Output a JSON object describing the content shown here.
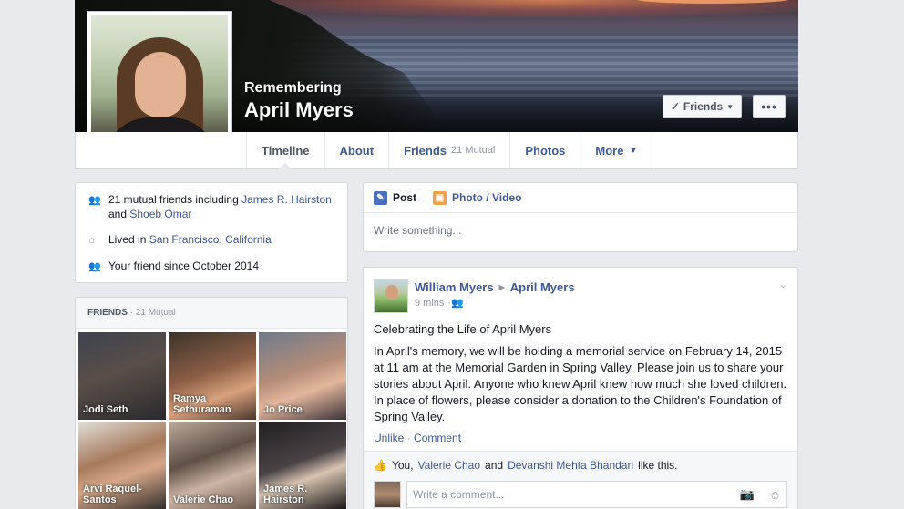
{
  "cover": {
    "subtitle": "Remembering",
    "name": "April Myers"
  },
  "header_buttons": {
    "friends_label": "Friends",
    "friends_check_icon": "check-icon",
    "more_label": "•••"
  },
  "nav": {
    "tabs": [
      {
        "label": "Timeline"
      },
      {
        "label": "About"
      },
      {
        "label": "Friends",
        "count": "21 Mutual"
      },
      {
        "label": "Photos"
      },
      {
        "label": "More"
      }
    ]
  },
  "intro": {
    "mutual_prefix": "21 mutual friends including",
    "mutual_friend_1": "James R. Hairston",
    "mutual_and": "and",
    "mutual_friend_2": "Shoeb Omar",
    "lived_prefix": "Lived in",
    "lived_place": "San Francisco, California",
    "friend_since": "Your friend since October 2014"
  },
  "friends_box": {
    "title": "FRIENDS",
    "mutual": "· 21 Mutual",
    "tiles": [
      "Jodi Seth",
      "Ramya Sethuraman",
      "Jo Price",
      "Arvi Raquel-Santos",
      "Valerie Chao",
      "James R. Hairston"
    ]
  },
  "composer": {
    "post_label": "Post",
    "photo_label": "Photo / Video",
    "placeholder": "Write something..."
  },
  "post": {
    "author": "William Myers",
    "target": "April Myers",
    "time": "9 mins",
    "title": "Celebrating the Life of April Myers",
    "body": "In April's memory, we will be holding a memorial service on February 14, 2015 at 11 am at the Memorial Garden in Spring Valley. Please join us to share your stories about April. Anyone who knew April knew how much she loved children. In place of flowers, please consider a donation to the Children's Foundation of Spring Valley.",
    "unlike": "Unlike",
    "comment": "Comment",
    "likes_you": "You,",
    "likes_person_1": "Valerie Chao",
    "likes_and": "and",
    "likes_person_2": "Devanshi Mehta Bhandari",
    "likes_suffix": "like this.",
    "comment_placeholder": "Write a comment..."
  },
  "colors": {
    "link": "#3b5998",
    "page_bg": "#e9eaed"
  }
}
